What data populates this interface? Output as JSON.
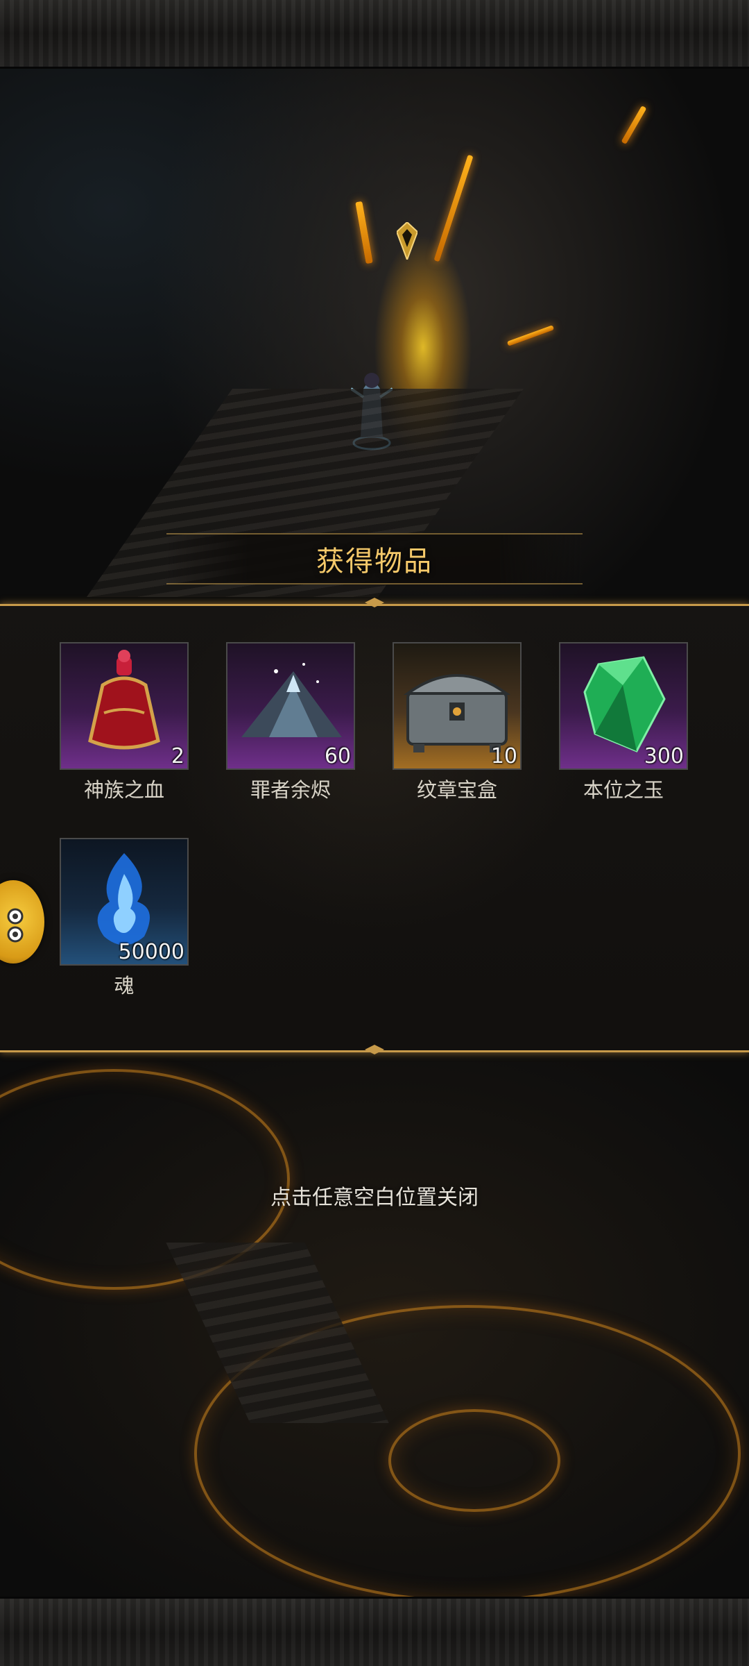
{
  "dialog": {
    "title": "获得物品",
    "close_hint": "点击任意空白位置关闭"
  },
  "items": [
    {
      "name": "神族之血",
      "count": "2",
      "rarity": "purple",
      "icon": "blood-bottle-icon"
    },
    {
      "name": "罪者余烬",
      "count": "60",
      "rarity": "purple",
      "icon": "ember-pile-icon"
    },
    {
      "name": "纹章宝盒",
      "count": "10",
      "rarity": "gold",
      "icon": "treasure-chest-icon"
    },
    {
      "name": "本位之玉",
      "count": "300",
      "rarity": "purple",
      "icon": "green-gem-icon"
    },
    {
      "name": "魂",
      "count": "50000",
      "rarity": "blue",
      "icon": "blue-soul-flame-icon"
    }
  ],
  "colors": {
    "title_gold": "#f5c96a",
    "panel_border": "#c79a4a",
    "rarity_purple": "#6f2f8a",
    "rarity_gold": "#a36e23",
    "rarity_blue": "#23507a"
  }
}
